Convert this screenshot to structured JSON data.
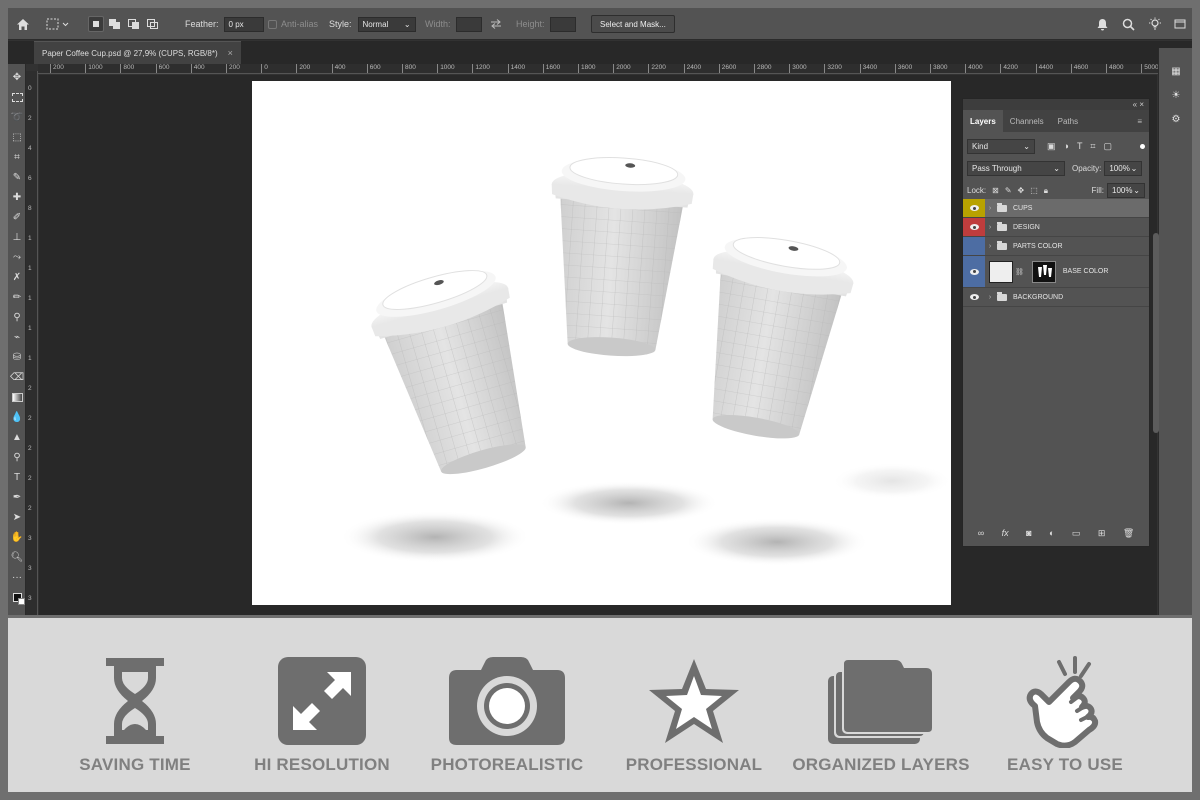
{
  "options_bar": {
    "feather_label": "Feather:",
    "feather_value": "0 px",
    "anti_alias_label": "Anti-alias",
    "style_label": "Style:",
    "style_value": "Normal",
    "width_label": "Width:",
    "height_label": "Height:",
    "select_mask_label": "Select and Mask..."
  },
  "document_tab": {
    "title": "Paper Coffee Cup.psd @ 27,9% (CUPS, RGB/8*)",
    "close": "×"
  },
  "ruler": {
    "horizontal": [
      "200",
      "1000",
      "800",
      "600",
      "400",
      "200",
      "0",
      "200",
      "400",
      "600",
      "800",
      "1000",
      "1200",
      "1400",
      "1600",
      "1800",
      "2000",
      "2200",
      "2400",
      "2600",
      "2800",
      "3000",
      "3200",
      "3400",
      "3600",
      "3800",
      "4000",
      "4200",
      "4400",
      "4600",
      "4800",
      "5000"
    ],
    "vertical": [
      "0",
      "2",
      "4",
      "6",
      "8",
      "1",
      "1",
      "1",
      "1",
      "1",
      "2",
      "2",
      "2",
      "2",
      "2",
      "3",
      "3",
      "3"
    ]
  },
  "layers_panel": {
    "top_controls": "« ×",
    "tabs": [
      "Layers",
      "Channels",
      "Paths"
    ],
    "menu_icon": "≡",
    "filter_label": "Kind",
    "blend_mode": "Pass Through",
    "opacity_label": "Opacity:",
    "opacity_value": "100%",
    "lock_label": "Lock:",
    "fill_label": "Fill:",
    "fill_value": "100%",
    "layers": [
      {
        "name": "CUPS",
        "color": "#b8a200",
        "visible": true,
        "type": "group",
        "selected": true
      },
      {
        "name": "DESIGN",
        "color": "#bf3d3d",
        "visible": true,
        "type": "group",
        "selected": false
      },
      {
        "name": "PARTS COLOR",
        "color": "#4d6da3",
        "visible": false,
        "type": "group",
        "selected": false
      },
      {
        "name": "BASE COLOR",
        "color": "#4d6da3",
        "visible": true,
        "type": "smart-object",
        "selected": false
      },
      {
        "name": "BACKGROUND",
        "color": "",
        "visible": true,
        "type": "group",
        "selected": false
      }
    ],
    "footer_icons": [
      "link-icon",
      "fx-icon",
      "mask-icon",
      "adjustment-icon",
      "folder-icon",
      "new-layer-icon",
      "trash-icon"
    ]
  },
  "features": [
    {
      "label": "SAVING TIME",
      "icon": "hourglass-icon"
    },
    {
      "label": "HI RESOLUTION",
      "icon": "expand-arrows-icon"
    },
    {
      "label": "PHOTOREALISTIC",
      "icon": "camera-icon"
    },
    {
      "label": "PROFESSIONAL",
      "icon": "star-icon"
    },
    {
      "label": "ORGANIZED LAYERS",
      "icon": "stacked-folders-icon"
    },
    {
      "label": "EASY TO USE",
      "icon": "tap-hand-icon"
    }
  ],
  "colors": {
    "feature_icon": "#6e6e6e",
    "feature_text": "#808080",
    "strip_bg": "#d9d9d9"
  }
}
